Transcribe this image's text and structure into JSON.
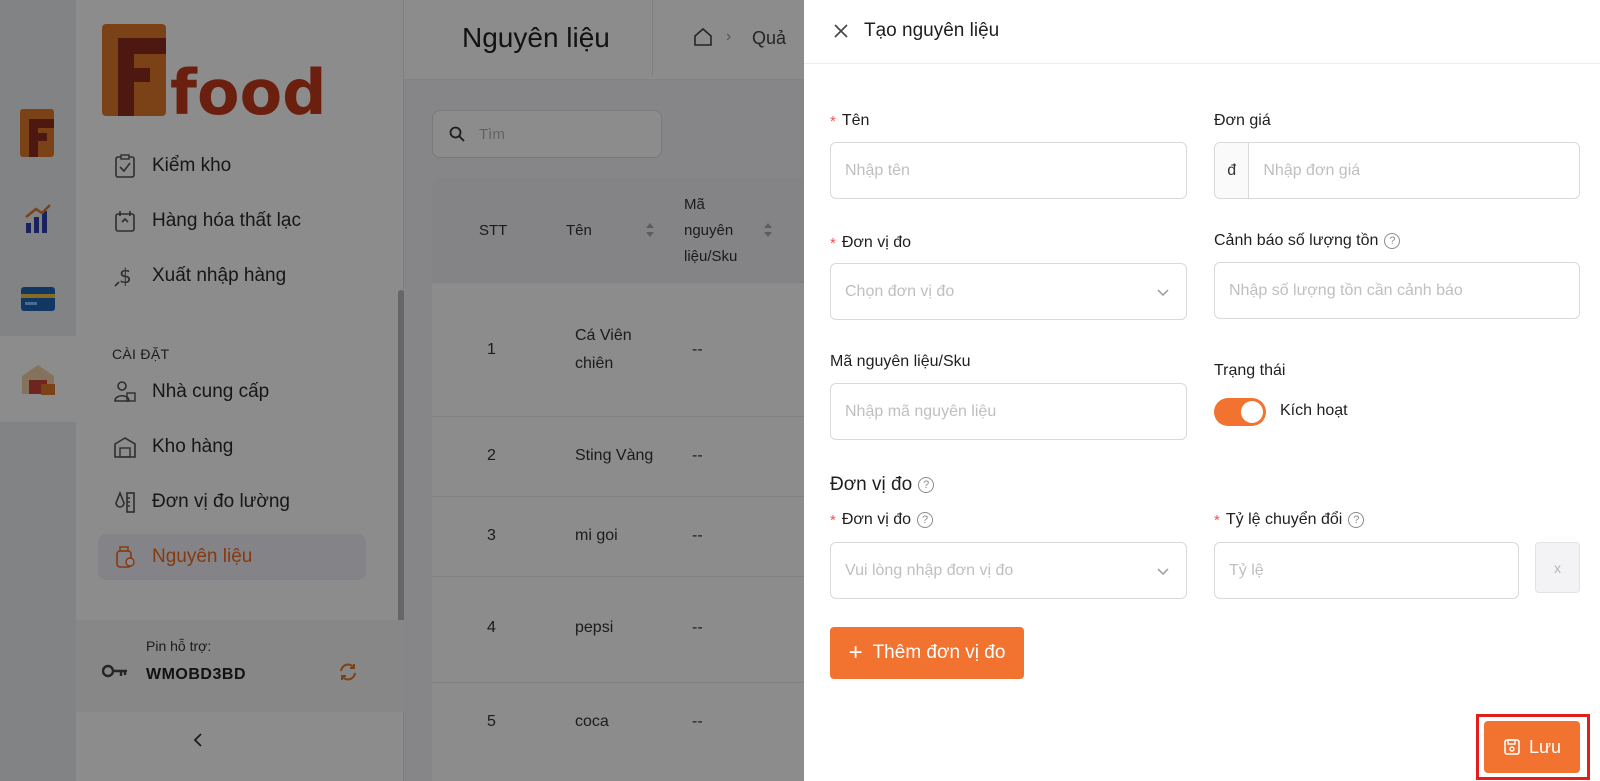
{
  "brand": {
    "logo_text": "Ffood",
    "accent": "#f27230"
  },
  "sidebar": {
    "items": [
      {
        "label": "Kiểm kho",
        "icon": "clipboard-check-icon"
      },
      {
        "label": "Hàng hóa thất lạc",
        "icon": "lost-goods-icon"
      },
      {
        "label": "Xuất nhập hàng",
        "icon": "dollar-exchange-icon"
      },
      {
        "label": "Nhà cung cấp",
        "icon": "supplier-icon"
      },
      {
        "label": "Kho hàng",
        "icon": "warehouse-icon"
      },
      {
        "label": "Đơn vị đo lường",
        "icon": "measure-icon"
      },
      {
        "label": "Nguyên liệu",
        "icon": "ingredient-icon"
      }
    ],
    "section_label": "CÀI ĐẶT",
    "support": {
      "label": "Pin hỗ trợ:",
      "pin": "WMOBD3BD"
    }
  },
  "header": {
    "title": "Nguyên liệu",
    "breadcrumb": "Quả"
  },
  "search": {
    "placeholder": "Tìm"
  },
  "table": {
    "columns": {
      "stt": "STT",
      "name": "Tên",
      "sku_l1": "Mã",
      "sku_l2": "nguyên",
      "sku_l3": "liệu/Sku"
    },
    "rows": [
      {
        "stt": "1",
        "name_l1": "Cá Viên",
        "name_l2": "chiên",
        "sku": "--"
      },
      {
        "stt": "2",
        "name_l1": "Sting Vàng",
        "name_l2": "",
        "sku": "--"
      },
      {
        "stt": "3",
        "name_l1": "mi goi",
        "name_l2": "",
        "sku": "--"
      },
      {
        "stt": "4",
        "name_l1": "pepsi",
        "name_l2": "",
        "sku": "--"
      },
      {
        "stt": "5",
        "name_l1": "coca",
        "name_l2": "",
        "sku": "--"
      }
    ]
  },
  "drawer": {
    "title": "Tạo nguyên liệu",
    "name": {
      "label": "Tên",
      "placeholder": "Nhập tên"
    },
    "price": {
      "label": "Đơn giá",
      "currency": "đ",
      "placeholder": "Nhập đơn giá"
    },
    "unit": {
      "label": "Đơn vị đo",
      "placeholder": "Chọn đơn vị đo"
    },
    "stock_alert": {
      "label": "Cảnh báo số lượng tồn",
      "placeholder": "Nhập số lượng tồn cần cảnh báo"
    },
    "sku": {
      "label": "Mã nguyên liệu/Sku",
      "placeholder": "Nhập mã nguyên liệu"
    },
    "status": {
      "label": "Trạng thái",
      "toggle_text": "Kích hoạt",
      "enabled": true
    },
    "units_section": {
      "title": "Đơn vị đo"
    },
    "unit_row": {
      "unit_label": "Đơn vị đo",
      "unit_placeholder": "Vui lòng nhập đơn vị đo",
      "ratio_label": "Tỷ lệ chuyển đổi",
      "ratio_placeholder": "Tỷ lệ",
      "remove": "x"
    },
    "add_unit_button": "Thêm đơn vị đo",
    "save_button": "Lưu"
  }
}
